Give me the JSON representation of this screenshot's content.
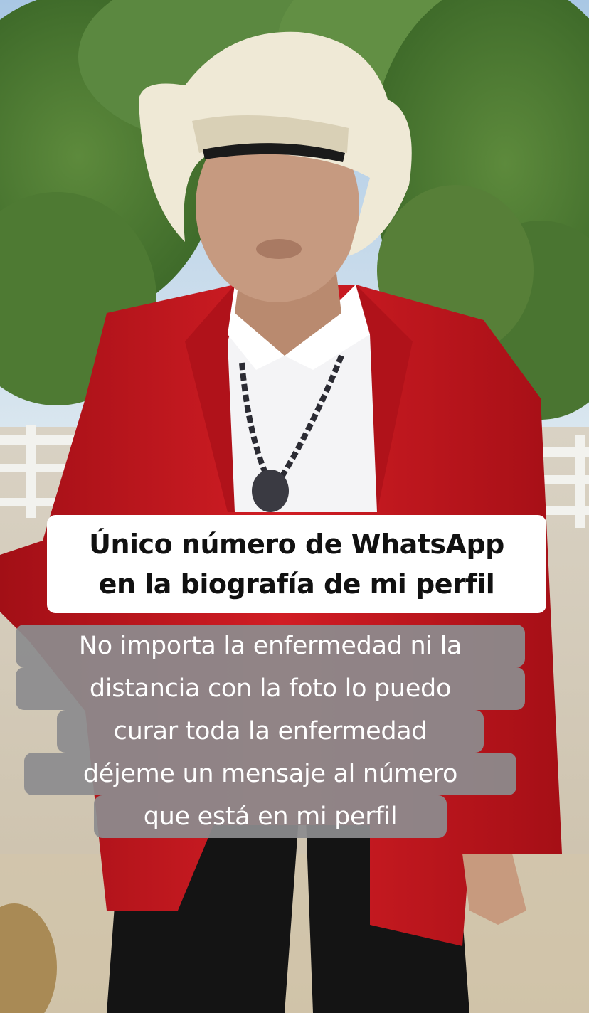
{
  "overlay": {
    "title_lines": [
      "Único número de WhatsApp",
      "en la biografía de mi perfil"
    ],
    "message_lines": [
      "No importa la enfermedad ni la",
      "distancia con la foto lo puedo",
      "curar toda la enfermedad",
      "déjeme un mensaje al número",
      "que está en mi perfil"
    ]
  },
  "colors": {
    "jacket": "#c4151c",
    "hat": "#efe9d6",
    "caption_white_bg": "#ffffff",
    "caption_gray_bg": "#8c8c8e"
  }
}
